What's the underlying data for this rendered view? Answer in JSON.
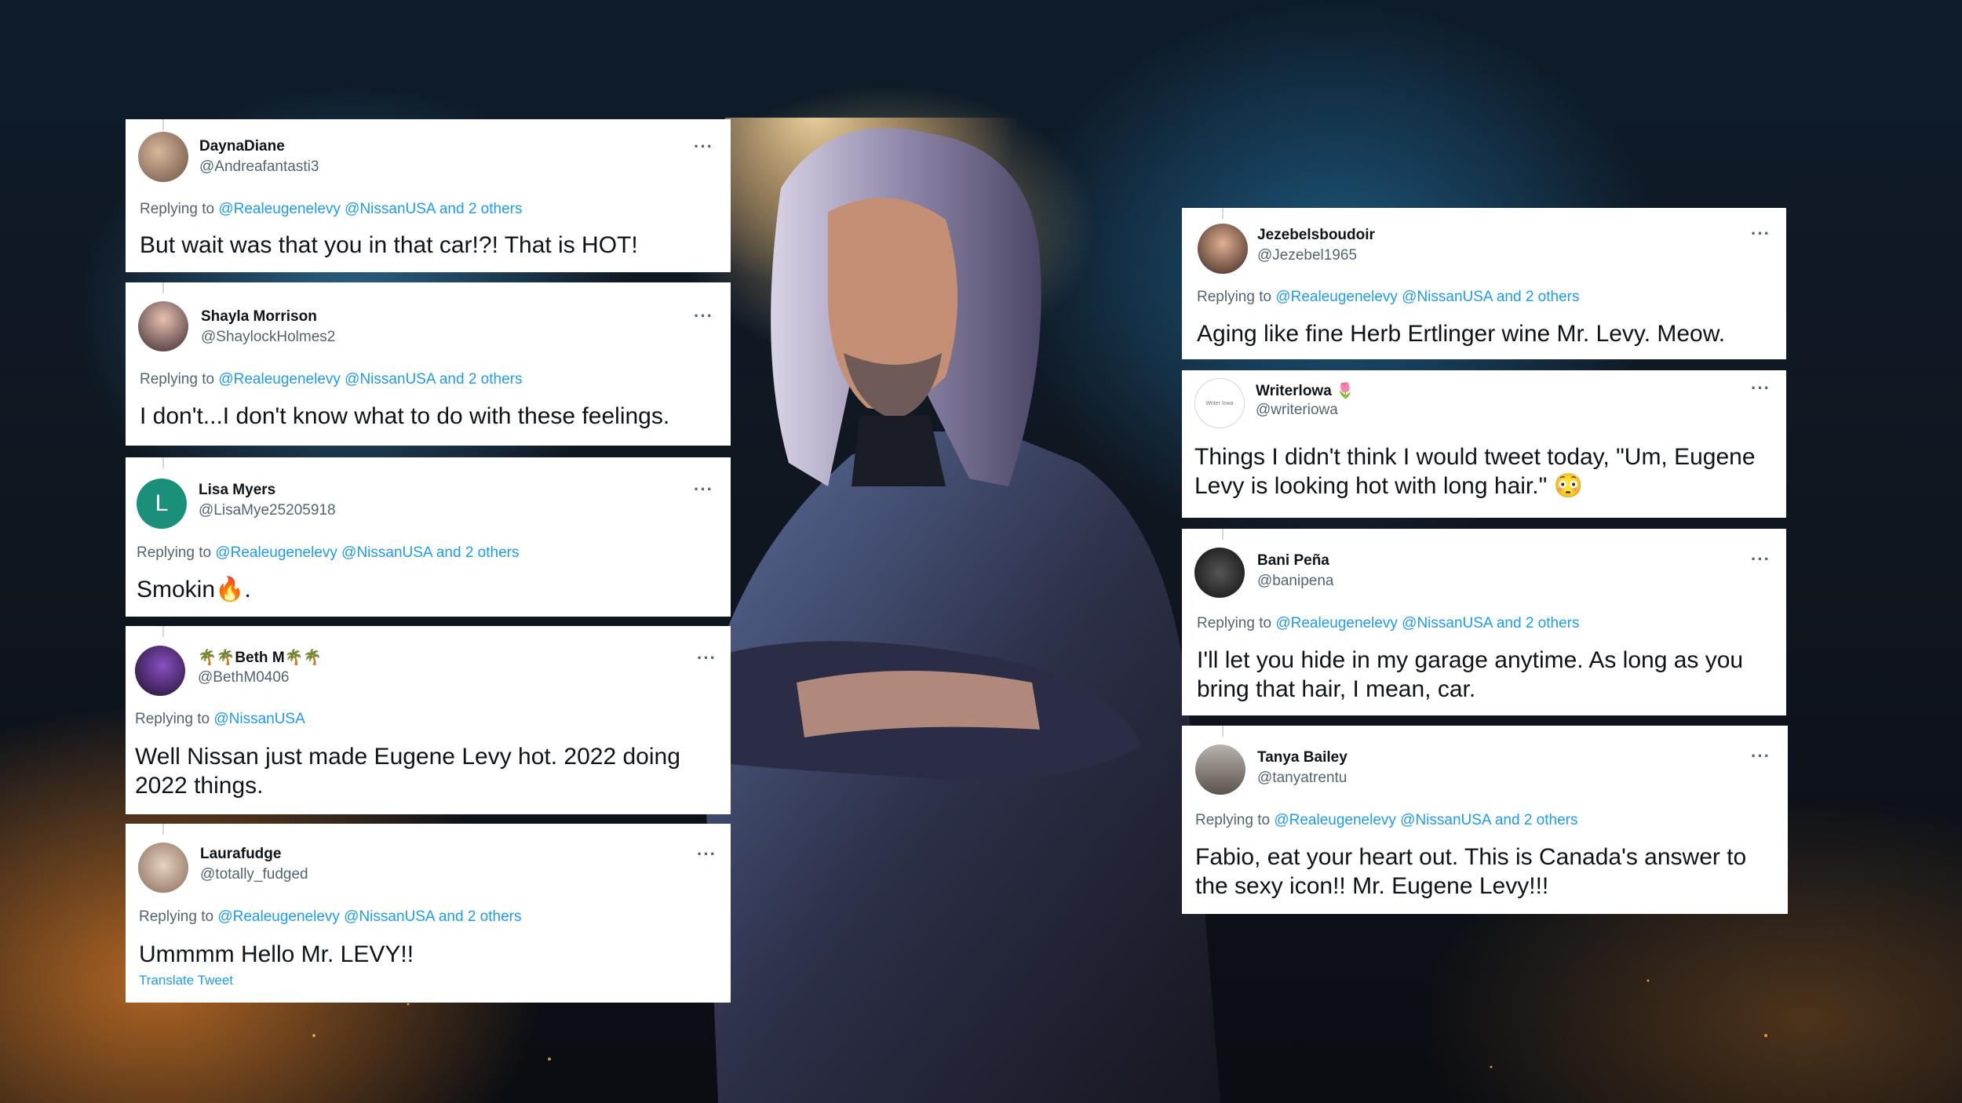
{
  "colors": {
    "link": "#1d9bf0",
    "text": "#0f1419",
    "muted": "#536471"
  },
  "tweets": [
    {
      "name": "DaynaDiane",
      "handle": "@Andreafantasti3",
      "replying_label": "Replying to",
      "replying_to": "@Realeugenelevy @NissanUSA and 2 others",
      "text": "But wait was that you in that car!?! That is HOT!",
      "more": "···"
    },
    {
      "name": "Shayla Morrison",
      "handle": "@ShaylockHolmes2",
      "replying_label": "Replying to",
      "replying_to": "@Realeugenelevy @NissanUSA and 2 others",
      "text": "I don't...I don't know what to do with these feelings.",
      "more": "···"
    },
    {
      "name": "Lisa Myers",
      "handle": "@LisaMye25205918",
      "avatar_letter": "L",
      "replying_label": "Replying to",
      "replying_to": "@Realeugenelevy @NissanUSA and 2 others",
      "text": "Smokin🔥.",
      "more": "···"
    },
    {
      "name": "🌴🌴Beth M🌴🌴",
      "handle": "@BethM0406",
      "replying_label": "Replying to",
      "replying_to": "@NissanUSA",
      "text": "Well Nissan just made Eugene Levy hot. 2022 doing 2022 things.",
      "more": "···"
    },
    {
      "name": "Laurafudge",
      "handle": "@totally_fudged",
      "replying_label": "Replying to",
      "replying_to": "@Realeugenelevy @NissanUSA and 2 others",
      "text": "Ummmm Hello Mr. LEVY!!",
      "translate": "Translate Tweet",
      "more": "···"
    },
    {
      "name": "Jezebelsboudoir",
      "handle": "@Jezebel1965",
      "replying_label": "Replying to",
      "replying_to": "@Realeugenelevy @NissanUSA and 2 others",
      "text": "Aging like fine Herb Ertlinger wine Mr. Levy. Meow.",
      "more": "···"
    },
    {
      "name": "Writerlowa 🌷",
      "handle": "@writeriowa",
      "avatar_text": "Writer Iowa",
      "text": "Things I didn't think I would tweet today, \"Um, Eugene Levy is looking hot with long hair.\" 😳",
      "more": "···"
    },
    {
      "name": "Bani Peña",
      "handle": "@banipena",
      "replying_label": "Replying to",
      "replying_to": "@Realeugenelevy @NissanUSA and 2 others",
      "text": "I'll let you hide in my garage anytime. As long as you bring that hair, I mean, car.",
      "more": "···"
    },
    {
      "name": "Tanya Bailey",
      "handle": "@tanyatrentu",
      "replying_label": "Replying to",
      "replying_to": "@Realeugenelevy @NissanUSA and 2 others",
      "text": "Fabio, eat your heart out.  This is Canada's answer to the sexy icon!!  Mr. Eugene Levy!!!",
      "more": "···"
    }
  ]
}
